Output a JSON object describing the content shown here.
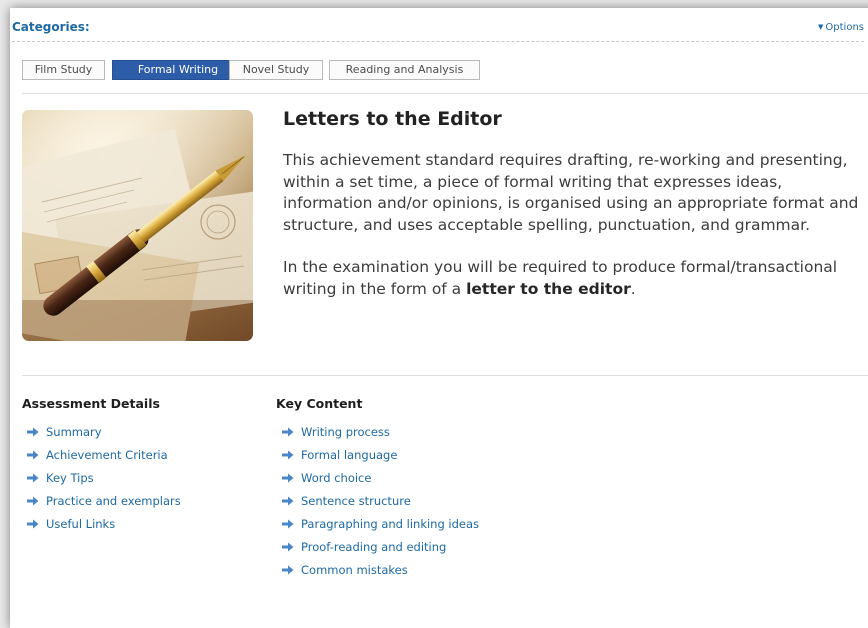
{
  "categories": {
    "title": "Categories:",
    "options_label": "Options",
    "tabs": [
      {
        "label": "Film Study",
        "active": false
      },
      {
        "label": "Formal Writing",
        "active": true
      },
      {
        "label": "Novel Study",
        "active": false
      },
      {
        "label": "Reading and Analysis",
        "active": false
      }
    ]
  },
  "feature": {
    "image_alt": "fountain pen resting on envelopes",
    "title": "Letters to the Editor",
    "paragraph1": "This achievement standard requires drafting, re-working and presenting, within a set time, a piece of formal writing that expresses ideas, information and/or opinions, is organised using an appropriate format and structure, and uses acceptable spelling, punctuation, and grammar.",
    "paragraph2_before": "In the examination you will be required to produce formal/transactional writing in the form of a ",
    "paragraph2_bold": "letter to the editor",
    "paragraph2_after": "."
  },
  "assessment": {
    "title": "Assessment Details",
    "links": [
      "Summary",
      "Achievement Criteria",
      "Key Tips",
      "Practice and exemplars",
      "Useful Links"
    ]
  },
  "key_content": {
    "title": "Key Content",
    "links": [
      "Writing process",
      "Formal language",
      "Word choice",
      "Sentence structure",
      "Paragraphing and linking ideas",
      "Proof-reading and editing",
      "Common mistakes"
    ]
  },
  "colors": {
    "link": "#1d6aa3",
    "active_tab": "#2d5ca8",
    "arrow_icon": "#4a86c5"
  },
  "icons": {
    "link_bullet": "arrow-right-icon",
    "options_toggle": "triangle-down-icon"
  }
}
